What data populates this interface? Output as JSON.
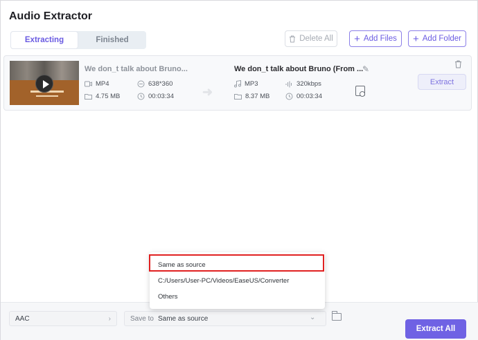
{
  "app": {
    "title": "Audio Extractor"
  },
  "tabs": [
    {
      "label": "Extracting",
      "active": true
    },
    {
      "label": "Finished",
      "active": false
    }
  ],
  "toolbar": {
    "delete_all": "Delete All",
    "add_files": "Add Files",
    "add_folder": "Add Folder"
  },
  "file": {
    "source": {
      "name": "We don_t talk about Bruno...",
      "format": "MP4",
      "resolution": "638*360",
      "size": "4.75 MB",
      "duration": "00:03:34"
    },
    "output": {
      "name": "We don_t talk about Bruno (From ...",
      "format": "MP3",
      "bitrate": "320kbps",
      "size": "8.37 MB",
      "duration": "00:03:34"
    },
    "extract_label": "Extract"
  },
  "footer": {
    "output_format": "AAC",
    "save_label": "Save to",
    "save_value": "Same as source",
    "extract_all": "Extract All"
  },
  "dropdown": {
    "options": [
      "Same as source",
      "C:/Users/User-PC/Videos/EaseUS/Converter",
      "Others"
    ],
    "highlighted_index": 0
  },
  "colors": {
    "accent": "#6f62e4",
    "highlight_border": "#e02020"
  }
}
